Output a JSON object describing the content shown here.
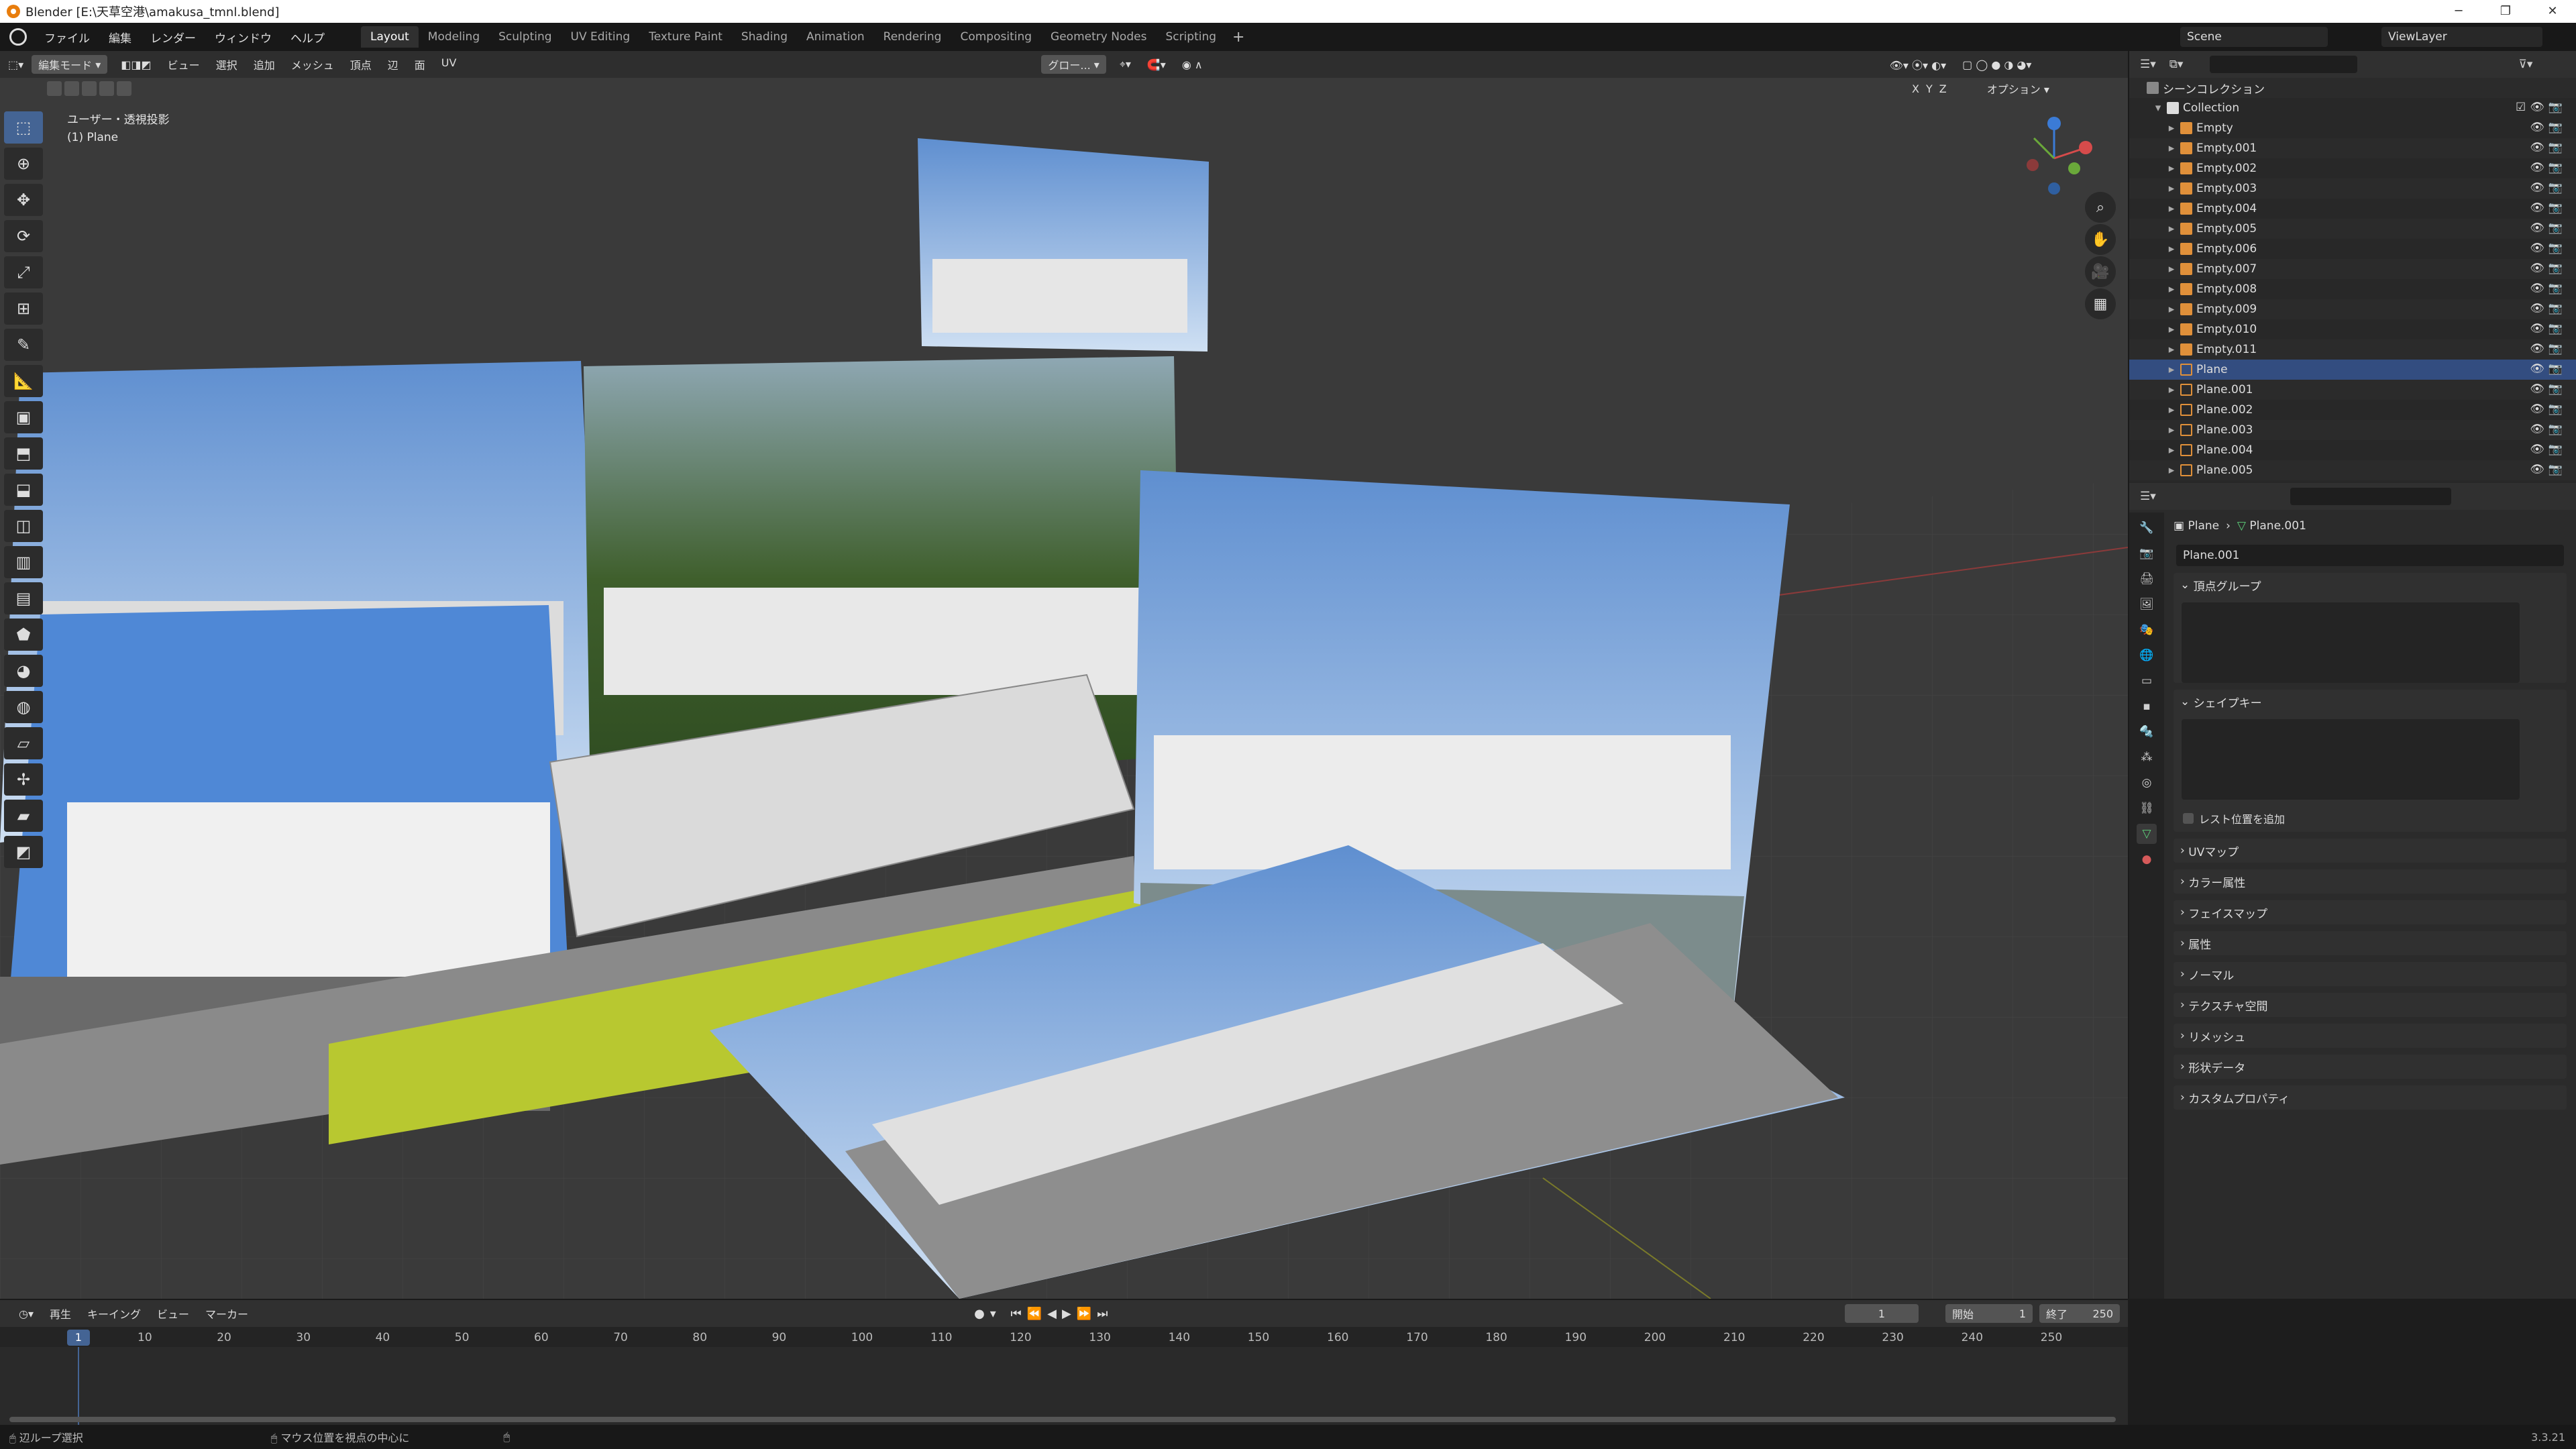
{
  "window": {
    "title": "Blender [E:\\天草空港\\amakusa_tmnl.blend]"
  },
  "menu": {
    "file": "ファイル",
    "edit": "編集",
    "render": "レンダー",
    "window": "ウィンドウ",
    "help": "ヘルプ"
  },
  "workspaces": [
    "Layout",
    "Modeling",
    "Sculpting",
    "UV Editing",
    "Texture Paint",
    "Shading",
    "Animation",
    "Rendering",
    "Compositing",
    "Geometry Nodes",
    "Scripting"
  ],
  "workspace_active": "Layout",
  "scene": {
    "name": "Scene",
    "view_layer": "ViewLayer"
  },
  "viewport": {
    "mode": "編集モード",
    "menus": [
      "ビュー",
      "選択",
      "追加",
      "メッシュ",
      "頂点",
      "辺",
      "面",
      "UV"
    ],
    "transform_orientation": "グロー...",
    "options": "オプション",
    "axes": [
      "X",
      "Y",
      "Z"
    ],
    "info_line1": "ユーザー・透視投影",
    "info_line2": "(1) Plane"
  },
  "outliner": {
    "scene_collection": "シーンコレクション",
    "collection": "Collection",
    "items": [
      {
        "name": "Empty",
        "type": "empty"
      },
      {
        "name": "Empty.001",
        "type": "empty"
      },
      {
        "name": "Empty.002",
        "type": "empty"
      },
      {
        "name": "Empty.003",
        "type": "empty"
      },
      {
        "name": "Empty.004",
        "type": "empty"
      },
      {
        "name": "Empty.005",
        "type": "empty"
      },
      {
        "name": "Empty.006",
        "type": "empty"
      },
      {
        "name": "Empty.007",
        "type": "empty"
      },
      {
        "name": "Empty.008",
        "type": "empty"
      },
      {
        "name": "Empty.009",
        "type": "empty"
      },
      {
        "name": "Empty.010",
        "type": "empty"
      },
      {
        "name": "Empty.011",
        "type": "empty"
      },
      {
        "name": "Plane",
        "type": "mesh",
        "selected": true
      },
      {
        "name": "Plane.001",
        "type": "mesh"
      },
      {
        "name": "Plane.002",
        "type": "mesh"
      },
      {
        "name": "Plane.003",
        "type": "mesh"
      },
      {
        "name": "Plane.004",
        "type": "mesh"
      },
      {
        "name": "Plane.005",
        "type": "mesh"
      }
    ]
  },
  "properties": {
    "breadcrumb_object": "Plane",
    "breadcrumb_mesh": "Plane.001",
    "mesh_datablock": "Plane.001",
    "panels_open": [
      "頂点グループ",
      "シェイプキー"
    ],
    "relative_checkbox": "レスト位置を追加",
    "panels_closed": [
      "UVマップ",
      "カラー属性",
      "フェイスマップ",
      "属性",
      "ノーマル",
      "テクスチャ空間",
      "リメッシュ",
      "形状データ",
      "カスタムプロパティ"
    ]
  },
  "timeline": {
    "menus": [
      "再生",
      "キーイング",
      "ビュー",
      "マーカー"
    ],
    "current_frame": "1",
    "start_label": "開始",
    "start": "1",
    "end_label": "終了",
    "end": "250",
    "ticks": [
      "10",
      "20",
      "30",
      "40",
      "50",
      "60",
      "70",
      "80",
      "90",
      "100",
      "110",
      "120",
      "130",
      "140",
      "150",
      "160",
      "170",
      "180",
      "190",
      "200",
      "210",
      "220",
      "230",
      "240",
      "250"
    ],
    "current_tick": "1"
  },
  "statusbar": {
    "item1": "辺ループ選択",
    "item2": "マウス位置を視点の中心に",
    "version": "3.3.21"
  }
}
